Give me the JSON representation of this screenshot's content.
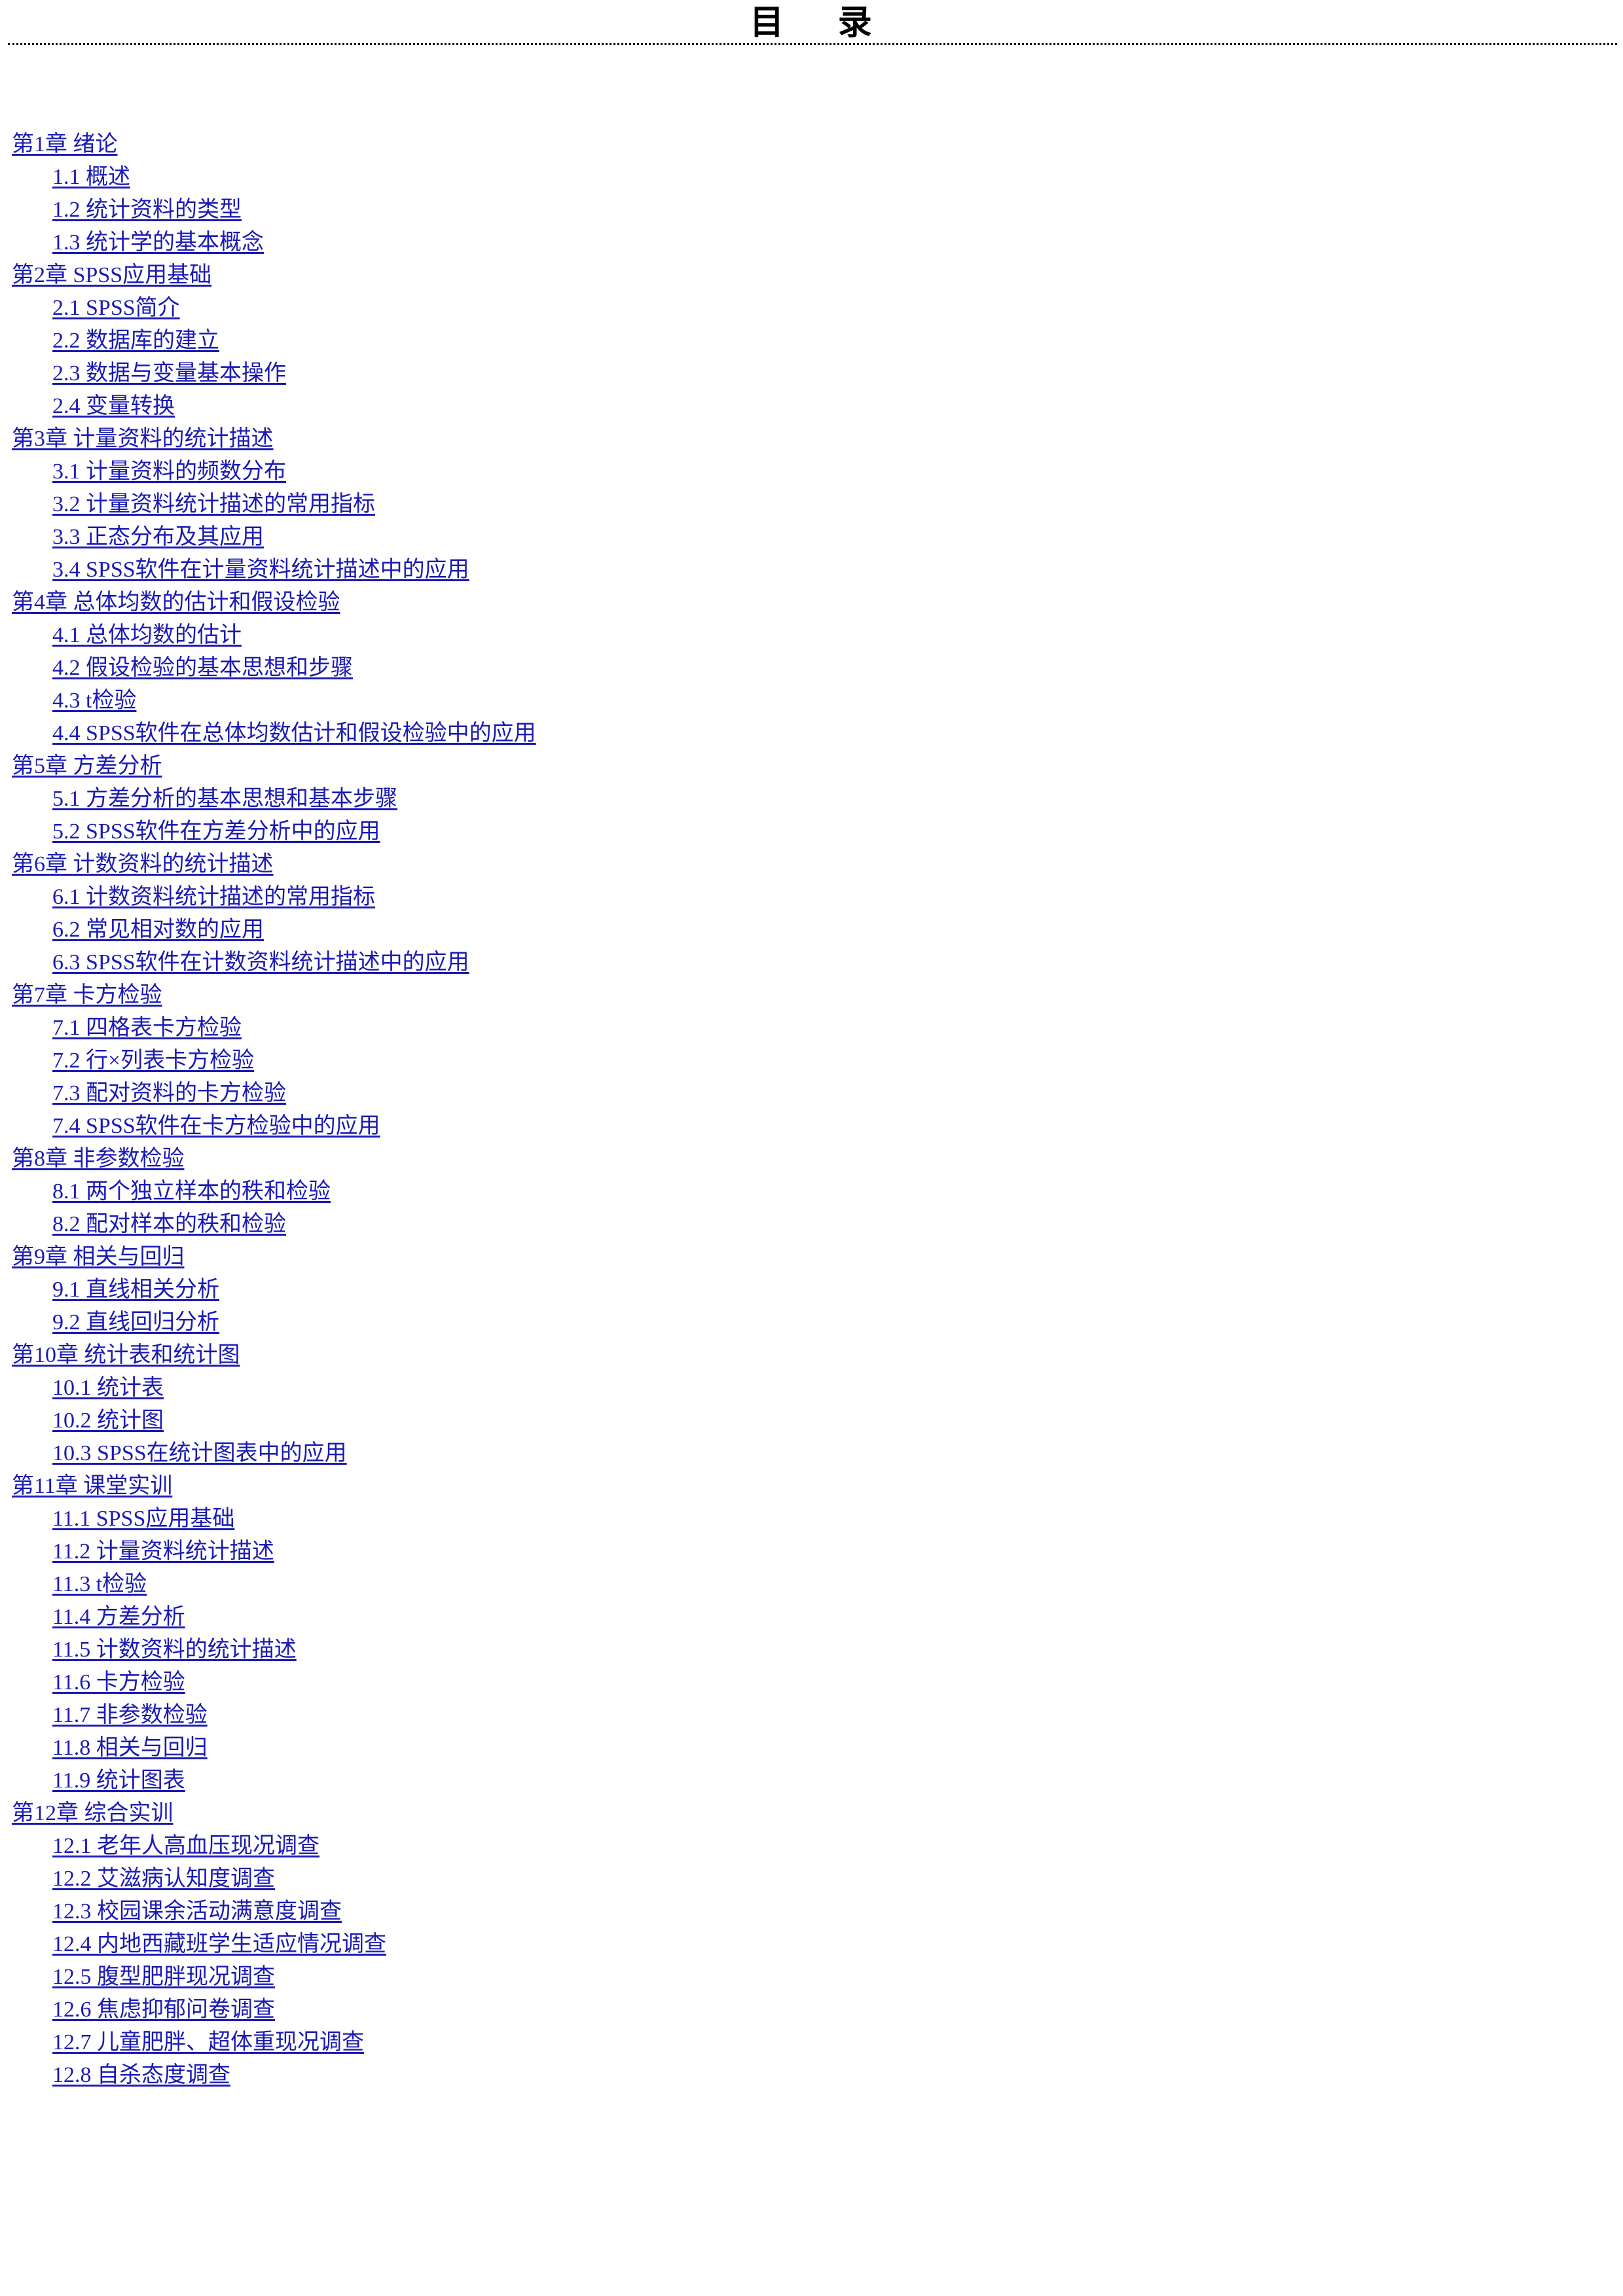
{
  "header": {
    "title": "目    录",
    "rule": "dotted-divider"
  },
  "toc": {
    "entries": [
      {
        "level": 1,
        "label": "第1章 绪论"
      },
      {
        "level": 2,
        "label": "1.1 概述"
      },
      {
        "level": 2,
        "label": "1.2 统计资料的类型"
      },
      {
        "level": 2,
        "label": "1.3 统计学的基本概念"
      },
      {
        "level": 1,
        "label": "第2章 SPSS应用基础"
      },
      {
        "level": 2,
        "label": "2.1 SPSS简介"
      },
      {
        "level": 2,
        "label": "2.2 数据库的建立"
      },
      {
        "level": 2,
        "label": "2.3 数据与变量基本操作"
      },
      {
        "level": 2,
        "label": "2.4 变量转换"
      },
      {
        "level": 1,
        "label": "第3章 计量资料的统计描述"
      },
      {
        "level": 2,
        "label": "3.1 计量资料的频数分布"
      },
      {
        "level": 2,
        "label": "3.2 计量资料统计描述的常用指标"
      },
      {
        "level": 2,
        "label": "3.3 正态分布及其应用"
      },
      {
        "level": 2,
        "label": "3.4 SPSS软件在计量资料统计描述中的应用"
      },
      {
        "level": 1,
        "label": "第4章 总体均数的估计和假设检验"
      },
      {
        "level": 2,
        "label": "4.1 总体均数的估计"
      },
      {
        "level": 2,
        "label": "4.2 假设检验的基本思想和步骤"
      },
      {
        "level": 2,
        "label": "4.3 t检验"
      },
      {
        "level": 2,
        "label": "4.4 SPSS软件在总体均数估计和假设检验中的应用"
      },
      {
        "level": 1,
        "label": "第5章 方差分析"
      },
      {
        "level": 2,
        "label": "5.1 方差分析的基本思想和基本步骤"
      },
      {
        "level": 2,
        "label": "5.2 SPSS软件在方差分析中的应用"
      },
      {
        "level": 1,
        "label": "第6章 计数资料的统计描述"
      },
      {
        "level": 2,
        "label": "6.1 计数资料统计描述的常用指标"
      },
      {
        "level": 2,
        "label": "6.2 常见相对数的应用"
      },
      {
        "level": 2,
        "label": "6.3 SPSS软件在计数资料统计描述中的应用"
      },
      {
        "level": 1,
        "label": "第7章 卡方检验"
      },
      {
        "level": 2,
        "label": "7.1 四格表卡方检验"
      },
      {
        "level": 2,
        "label": "7.2 行×列表卡方检验"
      },
      {
        "level": 2,
        "label": "7.3 配对资料的卡方检验"
      },
      {
        "level": 2,
        "label": "7.4 SPSS软件在卡方检验中的应用"
      },
      {
        "level": 1,
        "label": "第8章 非参数检验"
      },
      {
        "level": 2,
        "label": "8.1 两个独立样本的秩和检验"
      },
      {
        "level": 2,
        "label": "8.2 配对样本的秩和检验"
      },
      {
        "level": 1,
        "label": "第9章 相关与回归"
      },
      {
        "level": 2,
        "label": "9.1 直线相关分析"
      },
      {
        "level": 2,
        "label": "9.2 直线回归分析"
      },
      {
        "level": 1,
        "label": "第10章 统计表和统计图"
      },
      {
        "level": 2,
        "label": "10.1 统计表"
      },
      {
        "level": 2,
        "label": "10.2 统计图"
      },
      {
        "level": 2,
        "label": "10.3 SPSS在统计图表中的应用"
      },
      {
        "level": 1,
        "label": "第11章 课堂实训"
      },
      {
        "level": 2,
        "label": "11.1 SPSS应用基础"
      },
      {
        "level": 2,
        "label": "11.2 计量资料统计描述"
      },
      {
        "level": 2,
        "label": "11.3 t检验"
      },
      {
        "level": 2,
        "label": "11.4 方差分析"
      },
      {
        "level": 2,
        "label": "11.5 计数资料的统计描述"
      },
      {
        "level": 2,
        "label": "11.6 卡方检验"
      },
      {
        "level": 2,
        "label": "11.7 非参数检验"
      },
      {
        "level": 2,
        "label": "11.8 相关与回归"
      },
      {
        "level": 2,
        "label": "11.9 统计图表"
      },
      {
        "level": 1,
        "label": "第12章 综合实训"
      },
      {
        "level": 2,
        "label": "12.1 老年人高血压现况调查"
      },
      {
        "level": 2,
        "label": "12.2 艾滋病认知度调查"
      },
      {
        "level": 2,
        "label": "12.3 校园课余活动满意度调查"
      },
      {
        "level": 2,
        "label": "12.4 内地西藏班学生适应情况调查"
      },
      {
        "level": 2,
        "label": "12.5 腹型肥胖现况调查"
      },
      {
        "level": 2,
        "label": "12.6 焦虑抑郁问卷调查"
      },
      {
        "level": 2,
        "label": "12.7 儿童肥胖、超体重现况调查"
      },
      {
        "level": 2,
        "label": "12.8 自杀态度调查"
      }
    ]
  },
  "colors": {
    "link": "#1a1ab4",
    "text": "#000000",
    "background": "#ffffff"
  }
}
